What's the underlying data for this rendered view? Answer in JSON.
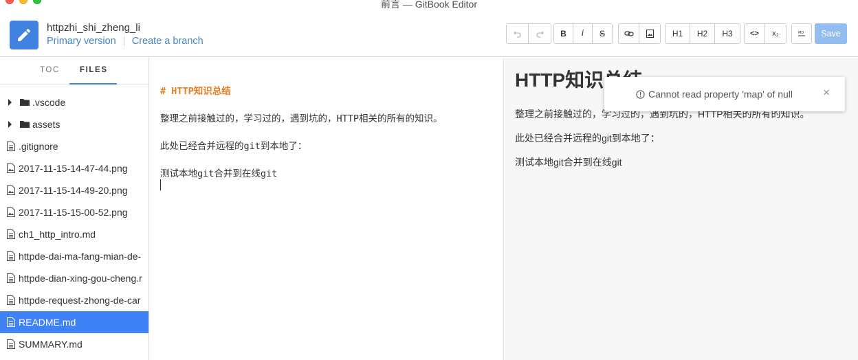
{
  "window": {
    "title": "前言 — GitBook Editor"
  },
  "header": {
    "book_title": "httpzhi_shi_zheng_li",
    "version_link": "Primary version",
    "branch_link": "Create a branch"
  },
  "toolbar": {
    "bold": "B",
    "italic": "i",
    "strike": "S",
    "h1": "H1",
    "h2": "H2",
    "h3": "H3",
    "code": "<>",
    "subscript": "x₂",
    "save": "Save"
  },
  "sidebar": {
    "tabs": {
      "toc": "TOC",
      "files": "FILES"
    },
    "files": [
      {
        "name": ".vscode",
        "type": "folder"
      },
      {
        "name": "assets",
        "type": "folder"
      },
      {
        "name": ".gitignore",
        "type": "file"
      },
      {
        "name": "2017-11-15-14-47-44.png",
        "type": "image"
      },
      {
        "name": "2017-11-15-14-49-20.png",
        "type": "image"
      },
      {
        "name": "2017-11-15-15-00-52.png",
        "type": "image"
      },
      {
        "name": "ch1_http_intro.md",
        "type": "file"
      },
      {
        "name": "httpde-dai-ma-fang-mian-de-",
        "type": "file"
      },
      {
        "name": "httpde-dian-xing-gou-cheng.r",
        "type": "file"
      },
      {
        "name": "httpde-request-zhong-de-car",
        "type": "file"
      },
      {
        "name": "README.md",
        "type": "file",
        "active": true
      },
      {
        "name": "SUMMARY.md",
        "type": "file"
      }
    ]
  },
  "editor": {
    "line1": "# HTTP知识总结",
    "line2": "整理之前接触过的，学习过的，遇到坑的，HTTP相关的所有的知识。",
    "line3": "此处已经合并远程的git到本地了：",
    "line4": "测试本地git合并到在线git"
  },
  "preview": {
    "title": "HTTP知识总结",
    "p1": "整理之前接触过的，学习过的，遇到坑的，HTTP相关的所有的知识。",
    "p2": "此处已经合并远程的git到本地了：",
    "p3": "测试本地git合并到在线git"
  },
  "toast": {
    "message": "Cannot read property 'map' of null",
    "close": "×"
  },
  "colors": {
    "accent": "#3f82e0",
    "active_row": "#3f82f5",
    "heading_md": "#e67e22",
    "save_disabled": "#93bcf0"
  }
}
